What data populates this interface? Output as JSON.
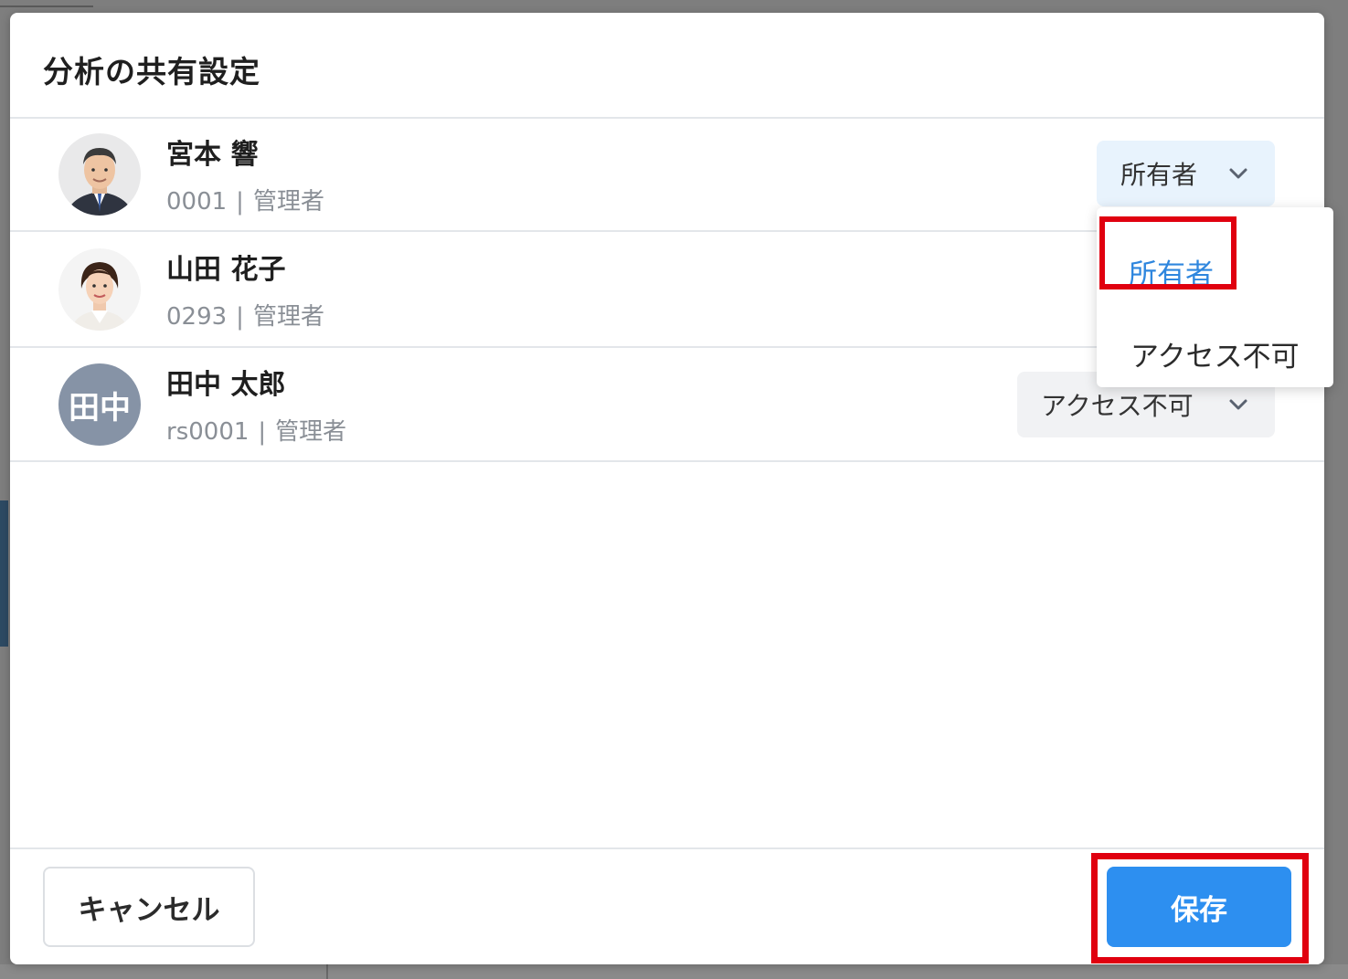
{
  "dialog": {
    "title": "分析の共有設定"
  },
  "users": [
    {
      "name": "宮本 響",
      "id": "0001",
      "role": "管理者",
      "avatar": "photo-man",
      "permission": "所有者"
    },
    {
      "name": "山田 花子",
      "id": "0293",
      "role": "管理者",
      "avatar": "photo-woman",
      "permission": "所有者"
    },
    {
      "name": "田中 太郎",
      "id": "rs0001",
      "role": "管理者",
      "avatar_initials": "田中",
      "permission": "アクセス不可"
    }
  ],
  "meta_separator": "|",
  "dropdown": {
    "options": [
      "所有者",
      "アクセス不可"
    ],
    "selected": "所有者"
  },
  "footer": {
    "cancel_label": "キャンセル",
    "save_label": "保存"
  },
  "colors": {
    "primary": "#2d8ff0",
    "selected_text": "#2e86de",
    "highlight": "#e0000f",
    "owner_select_bg": "#e8f3fd",
    "avatar_initials_bg": "#8693a6"
  },
  "icons": {
    "select_chevron": "chevron-down-icon"
  }
}
